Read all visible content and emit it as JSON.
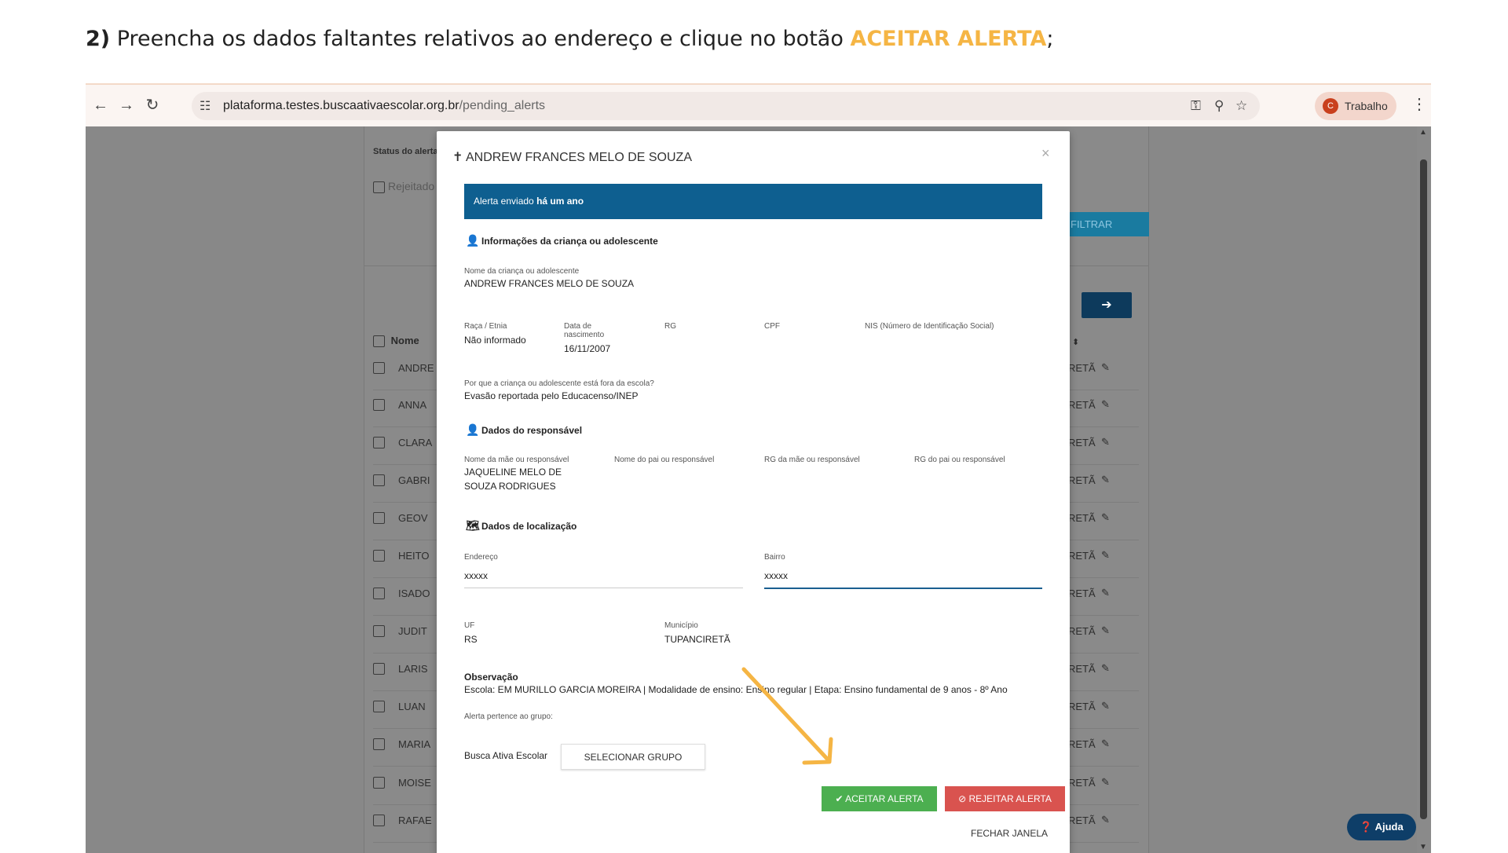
{
  "instruction": {
    "step": "2)",
    "text": " Preencha os dados faltantes relativos ao endereço e clique no botão ",
    "highlight": "ACEITAR ALERTA",
    "end": ";"
  },
  "browser": {
    "url_host": "plataforma.testes.buscaativaescolar.org.br",
    "url_path": "/pending_alerts",
    "back_icon": "←",
    "forward_icon": "→",
    "reload_icon": "↻",
    "tune_icon": "☷",
    "key_icon": "⚿",
    "zoom_icon": "⚲",
    "star_icon": "☆",
    "profile_initial": "C",
    "profile_name": "Trabalho",
    "menu_icon": "⋮"
  },
  "background": {
    "status_label": "Status do alerta",
    "rejeitado_label": "Rejeitado",
    "filtrar_label": "FILTRAR",
    "next_icon": "➔",
    "nome_header": "Nome",
    "sort_icon": "⬍",
    "rows": [
      "ANDRE",
      "ANNA",
      "CLARA",
      "GABRI",
      "GEOV",
      "HEITO",
      "ISADO",
      "JUDIT",
      "LARIS",
      "LUAN",
      "MARIA",
      "MOISE",
      "RAFAE"
    ],
    "municipio_suffix": "RETÃ",
    "edit_icon": "✎"
  },
  "modal": {
    "title_icon": "✝",
    "title": "ANDREW FRANCES MELO DE SOUZA",
    "close_icon": "×",
    "banner_prefix": "Alerta enviado ",
    "banner_bold": "há um ano",
    "section_crianca": "Informações da criança ou adolescente",
    "person_icon": "👤",
    "nome_label": "Nome da criança ou adolescente",
    "nome_value": "ANDREW FRANCES MELO DE SOUZA",
    "raca_label": "Raça / Etnia",
    "raca_value": "Não informado",
    "nasc_label_1": "Data de",
    "nasc_label_2": "nascimento",
    "nasc_value": "16/11/2007",
    "rg_label": "RG",
    "cpf_label": "CPF",
    "nis_label": "NIS (Número de Identificação Social)",
    "motivo_label": "Por que a criança ou adolescente está fora da escola?",
    "motivo_value": "Evasão reportada pelo Educacenso/INEP",
    "section_responsavel": "Dados do responsável",
    "mae_label": "Nome da mãe ou responsável",
    "mae_value_1": "JAQUELINE MELO DE",
    "mae_value_2": "SOUZA RODRIGUES",
    "pai_label": "Nome do pai ou responsável",
    "rg_mae_label": "RG da mãe ou responsável",
    "rg_pai_label": "RG do pai ou responsável",
    "section_localizacao": "Dados de localização",
    "map_icon": "🗺",
    "endereco_label": "Endereço",
    "endereco_value": "xxxxx",
    "bairro_label": "Bairro",
    "bairro_value": "xxxxx",
    "uf_label": "UF",
    "uf_value": "RS",
    "municipio_label": "Município",
    "municipio_value": "TUPANCIRETÃ",
    "observacao_label": "Observação",
    "observacao_value": "Escola: EM MURILLO GARCIA MOREIRA | Modalidade de ensino: Ensino regular | Etapa: Ensino fundamental de 9 anos - 8º Ano",
    "grupo_label": "Alerta pertence ao grupo:",
    "grupo_value": "Busca Ativa Escolar",
    "selecionar_grupo": "SELECIONAR GRUPO",
    "aceitar": "✔ ACEITAR ALERTA",
    "rejeitar": "⊘ REJEITAR ALERTA",
    "fechar": "FECHAR JANELA"
  },
  "ajuda": "❓ Ajuda",
  "colors": {
    "highlight": "#f5b544",
    "banner": "#0e5f90",
    "accept": "#4caf50",
    "reject": "#d9534f",
    "arrow": "#f5b544"
  },
  "scroll_up": "▲",
  "scroll_down": "▼"
}
